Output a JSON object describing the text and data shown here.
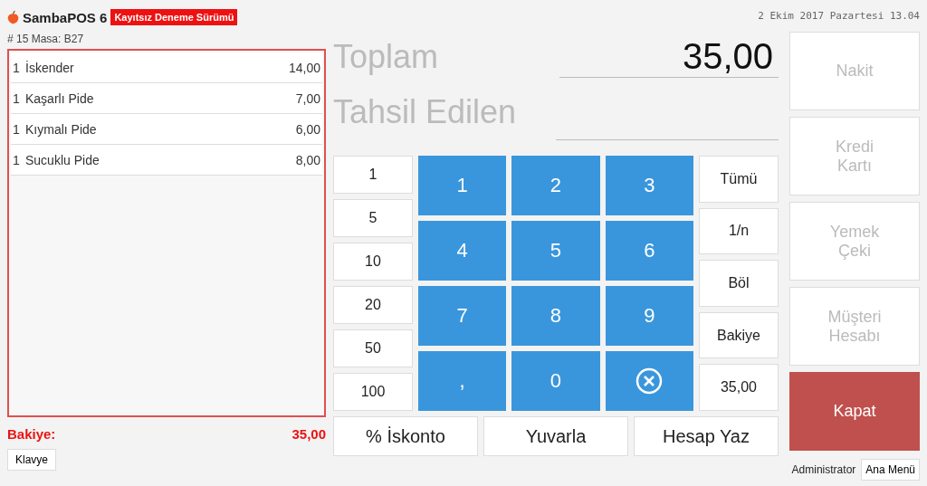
{
  "app": {
    "name": "SambaPOS 6",
    "badge": "Kayıtsız Deneme Sürümü",
    "datetime": "2 Ekim 2017 Pazartesi 13.04"
  },
  "ticket": {
    "title": "# 15 Masa: B27",
    "items": [
      {
        "qty": "1",
        "name": "İskender",
        "price": "14,00"
      },
      {
        "qty": "1",
        "name": "Kaşarlı Pide",
        "price": "7,00"
      },
      {
        "qty": "1",
        "name": "Kıymalı Pide",
        "price": "6,00"
      },
      {
        "qty": "1",
        "name": "Sucuklu Pide",
        "price": "8,00"
      }
    ],
    "balance_label": "Bakiye:",
    "balance": "35,00"
  },
  "keyboard_button": "Klavye",
  "total": {
    "label": "Toplam",
    "value": "35,00"
  },
  "tendered": {
    "label": "Tahsil Edilen"
  },
  "amount_buttons": [
    "1",
    "5",
    "10",
    "20",
    "50",
    "100"
  ],
  "numpad": [
    {
      "kind": "digit",
      "label": "1"
    },
    {
      "kind": "digit",
      "label": "2"
    },
    {
      "kind": "digit",
      "label": "3"
    },
    {
      "kind": "digit",
      "label": "4"
    },
    {
      "kind": "digit",
      "label": "5"
    },
    {
      "kind": "digit",
      "label": "6"
    },
    {
      "kind": "digit",
      "label": "7"
    },
    {
      "kind": "digit",
      "label": "8"
    },
    {
      "kind": "digit",
      "label": "9"
    },
    {
      "kind": "digit",
      "label": ","
    },
    {
      "kind": "digit",
      "label": "0"
    },
    {
      "kind": "clear"
    }
  ],
  "split_buttons": [
    "Tümü",
    "1/n",
    "Böl",
    "Bakiye",
    "35,00"
  ],
  "bottom_buttons": [
    "% İskonto",
    "Yuvarla",
    "Hesap Yaz"
  ],
  "payment_methods": [
    {
      "label": "Nakit",
      "disabled": true
    },
    {
      "label": "Kredi\nKartı",
      "disabled": true
    },
    {
      "label": "Yemek\nÇeki",
      "disabled": true
    },
    {
      "label": "Müşteri\nHesabı",
      "disabled": true
    }
  ],
  "close_button": "Kapat",
  "user": "Administrator",
  "main_menu_button": "Ana Menü"
}
